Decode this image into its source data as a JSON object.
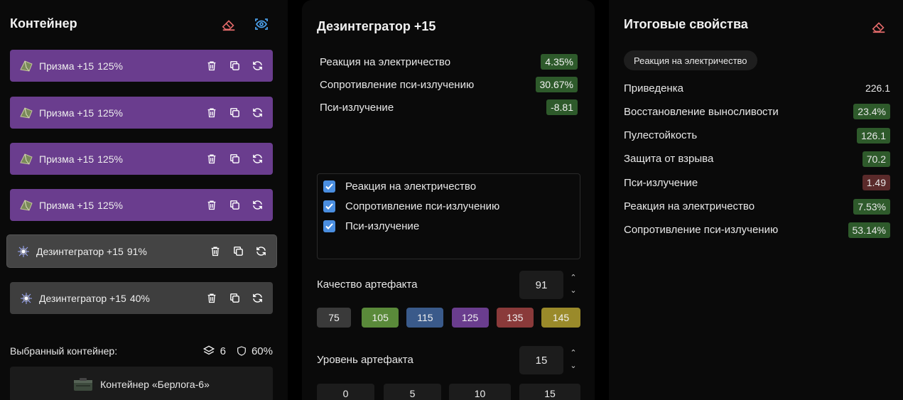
{
  "left": {
    "title": "Контейнер",
    "items": [
      {
        "name": "Призма +15",
        "pct": "125%",
        "style": "purple",
        "icon": "prism-artifact-icon"
      },
      {
        "name": "Призма +15",
        "pct": "125%",
        "style": "purple",
        "icon": "prism-artifact-icon"
      },
      {
        "name": "Призма +15",
        "pct": "125%",
        "style": "purple",
        "icon": "prism-artifact-icon"
      },
      {
        "name": "Призма +15",
        "pct": "125%",
        "style": "purple",
        "icon": "prism-artifact-icon"
      },
      {
        "name": "Дезинтегратор +15",
        "pct": "91%",
        "style": "gray-selected",
        "icon": "disintegrator-artifact-icon"
      },
      {
        "name": "Дезинтегратор +15",
        "pct": "40%",
        "style": "gray",
        "icon": "disintegrator-artifact-icon"
      }
    ],
    "selected_label": "Выбранный контейнер:",
    "slots": "6",
    "protection": "60%",
    "container_name": "Контейнер «Берлога-6»"
  },
  "mid": {
    "title": "Дезинтегратор +15",
    "props": [
      {
        "name": "Реакция на электричество",
        "value": "4.35%"
      },
      {
        "name": "Сопротивление пси-излучению",
        "value": "30.67%"
      },
      {
        "name": "Пси-излучение",
        "value": "-8.81"
      }
    ],
    "checks": [
      {
        "label": "Реакция на электричество",
        "checked": true
      },
      {
        "label": "Сопротивление пси-излучению",
        "checked": true
      },
      {
        "label": "Пси-излучение",
        "checked": true
      }
    ],
    "quality_label": "Качество артефакта",
    "quality_value": "91",
    "quality_presets": [
      "75",
      "105",
      "115",
      "125",
      "135",
      "145"
    ],
    "level_label": "Уровень артефакта",
    "level_value": "15",
    "level_presets": [
      "0",
      "5",
      "10",
      "15"
    ],
    "spin_up": "⌃",
    "spin_down": "⌄"
  },
  "right": {
    "title": "Итоговые свойства",
    "tag": "Реакция на электричество",
    "rows": [
      {
        "name": "Приведенка",
        "value": "226.1",
        "tone": "plain"
      },
      {
        "name": "Восстановление выносливости",
        "value": "23.4%",
        "tone": "green"
      },
      {
        "name": "Пулестойкость",
        "value": "126.1",
        "tone": "green"
      },
      {
        "name": "Защита от взрыва",
        "value": "70.2",
        "tone": "green"
      },
      {
        "name": "Пси-излучение",
        "value": "1.49",
        "tone": "red"
      },
      {
        "name": "Реакция на электричество",
        "value": "7.53%",
        "tone": "green"
      },
      {
        "name": "Сопротивление пси-излучению",
        "value": "53.14%",
        "tone": "green"
      }
    ]
  },
  "colors": {
    "purple": "#6a3d8e",
    "gray": "#3e3e3e",
    "green_badge": "#2e5a2b",
    "red_badge": "#5a2a2a",
    "checkbox": "#4a8ee0",
    "eraser": "#e46a6a",
    "eye": "#4a9ee8",
    "chip_75": "#3a3a3a",
    "chip_105": "#5a8a3a",
    "chip_115": "#3a5a8a",
    "chip_125": "#6a3d8e",
    "chip_135": "#8a3a3a",
    "chip_145": "#9a8a2a"
  }
}
